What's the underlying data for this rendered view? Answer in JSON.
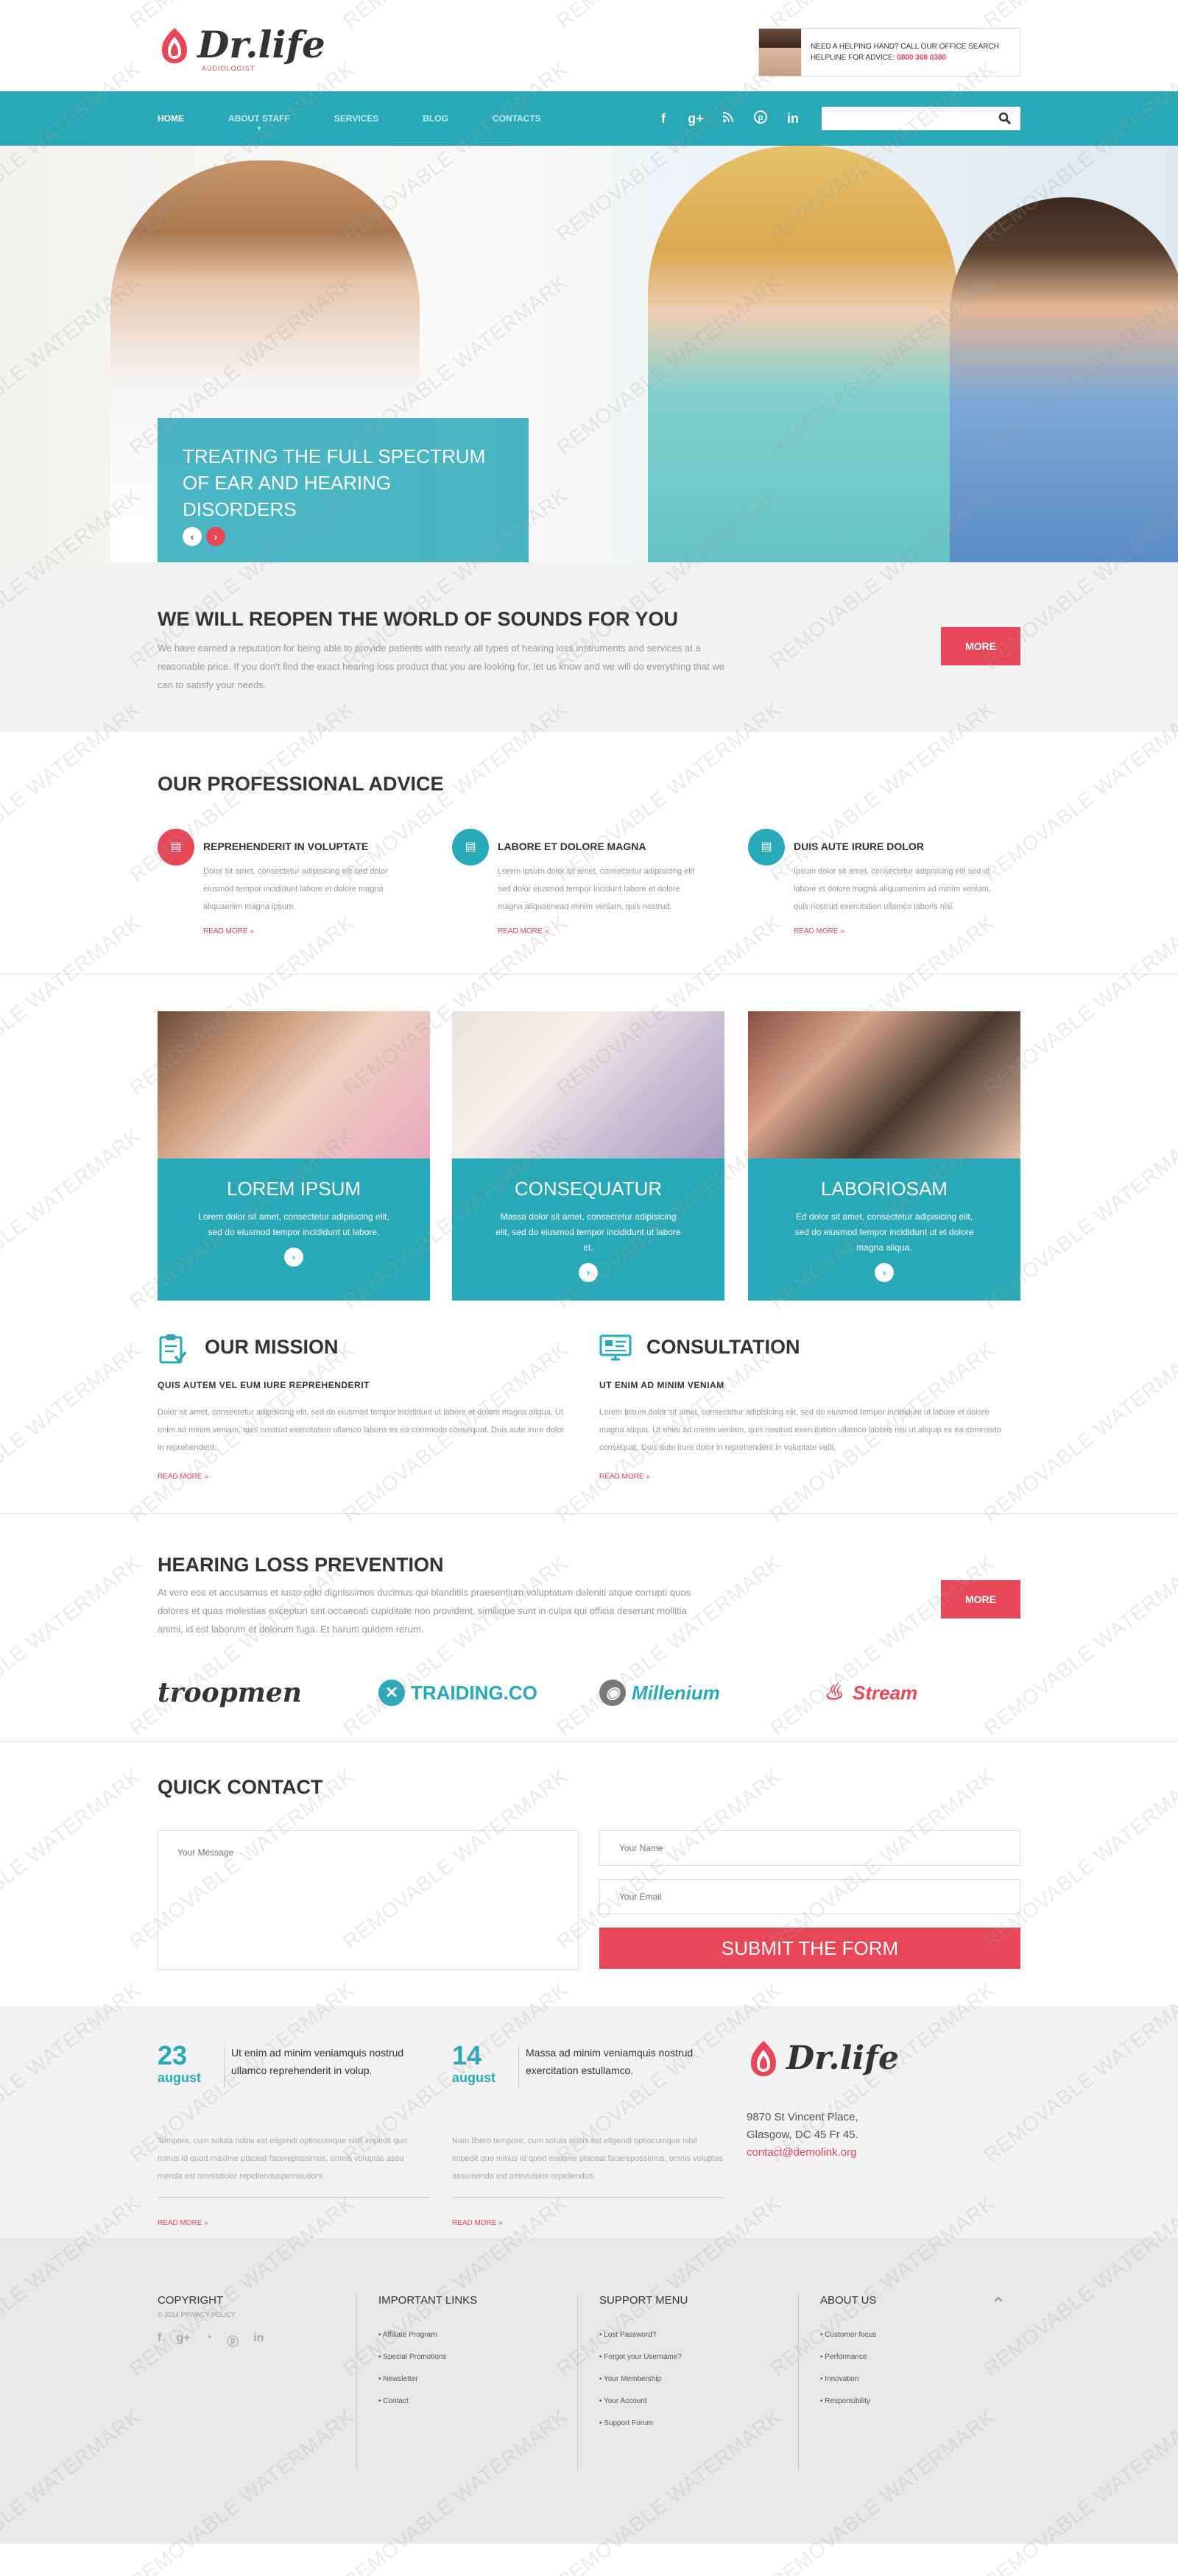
{
  "header": {
    "logo_text": "Dr.life",
    "logo_sub": "AUDIOLOGIST",
    "help_line1": "NEED A HELPING HAND? CALL OUR OFFICE SEARCH",
    "help_line2": "HELPLINE FOR ADVICE:",
    "help_phone": "0800 368 0380"
  },
  "nav": {
    "items": [
      {
        "label": "Home"
      },
      {
        "label": "About staff"
      },
      {
        "label": "Services"
      },
      {
        "label": "Blog"
      },
      {
        "label": "Contacts"
      }
    ],
    "socials": [
      "facebook-icon",
      "google-plus-icon",
      "rss-icon",
      "pinterest-icon",
      "linkedin-icon"
    ],
    "search_placeholder": ""
  },
  "hero": {
    "title_line1": "TREATING THE FULL SPECTRUM",
    "title_line2": "OF EAR AND HEARING DISORDERS",
    "prev": "‹",
    "next": "›"
  },
  "intro": {
    "title": "WE WILL REOPEN THE WORLD OF SOUNDS FOR YOU",
    "text": "We have earned a reputation for being able to provide patients with nearly all types of hearing loss instruments and services at a reasonable price. If you don't find the exact hearing loss product that you are looking for, let us know and we will do everything that we can to satisfy your needs.",
    "button": "MORE"
  },
  "advice": {
    "title": "OUR PROFESSIONAL ADVICE",
    "items": [
      {
        "title": "REPREHENDERIT IN VOLUPTATE",
        "text": "Dolor sit amet, consectetur adipisicing elit sed dolor eiusmod tempor incididunt labore et dolore magna aliquaenim magna ipsum.",
        "link": "READ MORE »"
      },
      {
        "title": "LABORE ET DOLORE MAGNA",
        "text": "Lorem ipsum dolor sit amet, consectetur adipisicing elit sed dolor eiusmod tempor incidunt labore et dolore magna aliquaenead minim veniam, quis nostrud.",
        "link": "READ MORE »"
      },
      {
        "title": "DUIS AUTE IRURE DOLOR",
        "text": "Ipsum dolor sit amet, consectetur adipisicing elit sed ut labore et dolore magna aliquamenim ad minim veniam, quis nostrud exercitation ullamco laboris nisi.",
        "link": "READ MORE »"
      }
    ]
  },
  "cards": [
    {
      "title": "LOREM IPSUM",
      "text": "Lorem dolor sit amet, consectetur adipisicing elit, sed do eiusmod tempor incididunt ut labore.",
      "go": "›"
    },
    {
      "title": "CONSEQUATUR",
      "text": "Massa dolor sit amet, consectetur adipisicing elit, sed do eiusmod tempor incididunt ut labore et.",
      "go": "›"
    },
    {
      "title": "LABORIOSAM",
      "text": "Ed dolor sit amet, consectetur adipisicing elit, sed do eiusmod tempor incididunt ut et dolore magna aliqua.",
      "go": "›"
    }
  ],
  "mission": {
    "title": "OUR MISSION",
    "subtitle": "QUIS AUTEM VEL EUM IURE REPREHENDERIT",
    "text": "Dolor sit amet, consectetur adipisicing elit, sed do eiusmod tempor incididunt ut labore et dolore magna aliqua. Ut enim ad minim veniam, quis nostrud exercitation ullamco laboris ex ea commodo consequat. Duis aute irure dolor in reprehenderit.",
    "link": "READ MORE »"
  },
  "consultation": {
    "title": "CONSULTATION",
    "subtitle": "UT ENIM AD MINIM VENIAM",
    "text": "Lorem ipsum dolor sit amet, consectetur adipisicing elit, sed do eiusmod tempor incididunt ut labore et dolore magna aliqua. Ut enim ad minim veniam, quis nostrud exercitation ullamco laboris nisi ut aliquip ex ea commodo consequat. Duis aute irure dolor in reprehenderit in voluptate velit.",
    "link": "READ MORE »"
  },
  "prevention": {
    "title": "HEARING LOSS PREVENTION",
    "text": "At vero eos et accusamus et iusto odio dignissimos ducimus qui blanditiis praesentium voluptatum deleniti atque corrupti quos dolores et quas molestias excepturi sint occaecati cupiditate non provident, similique sunt in culpa qui officia deserunt mollitia animi, id est laborum et dolorum fuga. Et harum quidem rerum.",
    "button": "MORE",
    "partners": [
      "troopmen",
      "TRAIDING.CO",
      "Millenium",
      "Stream"
    ]
  },
  "contact": {
    "title": "QUICK CONTACT",
    "message_placeholder": "Your Message",
    "name_placeholder": "Your Name",
    "email_placeholder": "Your Email",
    "submit": "SUBMIT THE FORM"
  },
  "news": [
    {
      "day": "23",
      "month": "august",
      "title": "Ut enim ad minim veniamquis nostrud ullamco reprehenderit in volup.",
      "text": "Tempore, cum soluta nobis est eligendi optiocumque nihil impedit quo minus id quod maxime placeat facerepossimus, omnis voluptas assu menda est omnisdolor repellenduspernaudors.",
      "link": "READ MORE »"
    },
    {
      "day": "14",
      "month": "august",
      "title": "Massa ad minim veniamquis nostrud exercitation estullamco.",
      "text": "Nam libero tempore, cum soluta nobis est eligendi optiocumque nihil impedit quo minus id quod maxime placeat facerepossimus, omnis voluptas assumenda est omnisdolor repellendus.",
      "link": "READ MORE »"
    }
  ],
  "footer_info": {
    "logo_text": "Dr.life",
    "address1": "9870 St Vincent Place,",
    "address2": "Glasgow, DC 45 Fr 45.",
    "email": "contact@demolink.org"
  },
  "footer": {
    "copyright_title": "COPYRIGHT",
    "copyright_text": "© 2014 PRIVACY POLICY",
    "important_title": "IMPORTANT LINKS",
    "important": [
      "Affiliate Program",
      "Special Promotions",
      "Newsletter",
      "Contact"
    ],
    "support_title": "SUPPORT MENU",
    "support": [
      "Lost Password?",
      "Forgot your Username?",
      "Your Membership",
      "Your Account",
      "Support Forum"
    ],
    "about_title": "ABOUT US",
    "about": [
      "Customer focus",
      "Performance",
      "Innovation",
      "Responsibility"
    ],
    "to_top": "⌃"
  },
  "watermark": "REMOVABLE WATERMARK",
  "colors": {
    "accent": "#29a9b8",
    "brand_red": "#e84758"
  }
}
